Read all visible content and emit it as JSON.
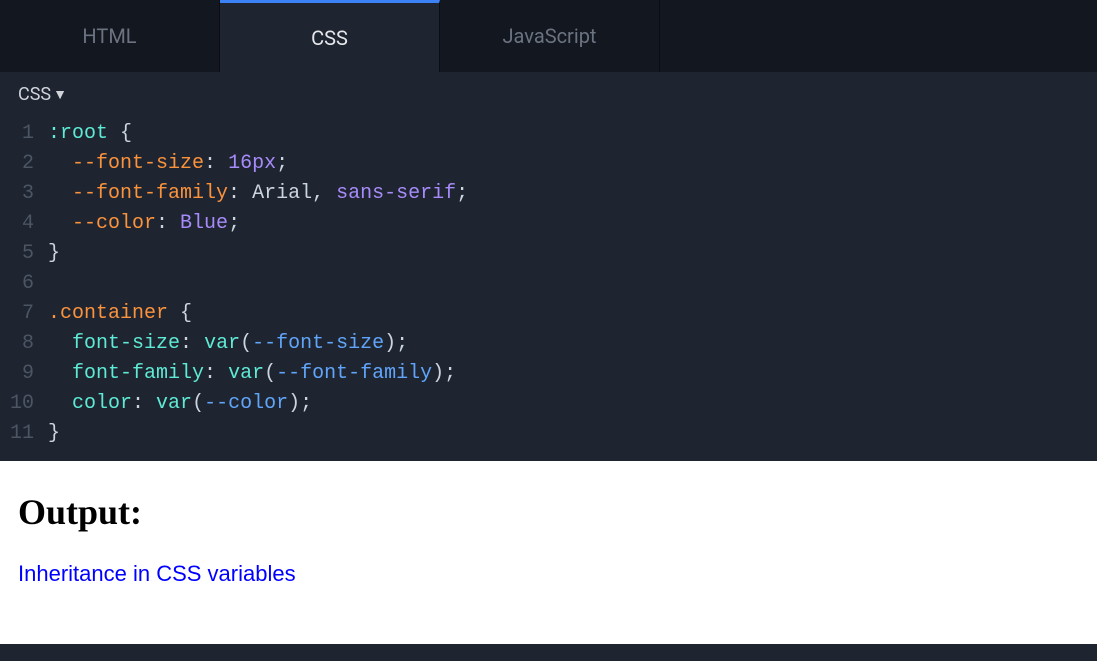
{
  "tabs": [
    {
      "label": "HTML",
      "active": false
    },
    {
      "label": "CSS",
      "active": true
    },
    {
      "label": "JavaScript",
      "active": false
    }
  ],
  "panel": {
    "language_label": "CSS",
    "dropdown_glyph": "▼"
  },
  "code_lines": [
    {
      "n": "1",
      "tokens": [
        [
          ":root",
          "tok-pseudo"
        ],
        [
          " {",
          "tok-punct"
        ]
      ]
    },
    {
      "n": "2",
      "tokens": [
        [
          "  ",
          ""
        ],
        [
          "--font-size",
          "tok-prop"
        ],
        [
          ": ",
          "tok-punct"
        ],
        [
          "16px",
          "tok-num"
        ],
        [
          ";",
          "tok-punct"
        ]
      ]
    },
    {
      "n": "3",
      "tokens": [
        [
          "  ",
          ""
        ],
        [
          "--font-family",
          "tok-prop"
        ],
        [
          ": ",
          "tok-punct"
        ],
        [
          "Arial",
          ""
        ],
        [
          ", ",
          "tok-punct"
        ],
        [
          "sans-serif",
          "tok-val2"
        ],
        [
          ";",
          "tok-punct"
        ]
      ]
    },
    {
      "n": "4",
      "tokens": [
        [
          "  ",
          ""
        ],
        [
          "--color",
          "tok-prop"
        ],
        [
          ": ",
          "tok-punct"
        ],
        [
          "Blue",
          "tok-val2"
        ],
        [
          ";",
          "tok-punct"
        ]
      ]
    },
    {
      "n": "5",
      "tokens": [
        [
          "}",
          "tok-punct"
        ]
      ]
    },
    {
      "n": "6",
      "tokens": [
        [
          "",
          ""
        ]
      ]
    },
    {
      "n": "7",
      "tokens": [
        [
          ".container",
          "tok-class"
        ],
        [
          " {",
          "tok-punct"
        ]
      ]
    },
    {
      "n": "8",
      "tokens": [
        [
          "  ",
          ""
        ],
        [
          "font-size",
          "tok-kw"
        ],
        [
          ": ",
          "tok-punct"
        ],
        [
          "var",
          "tok-kw"
        ],
        [
          "(",
          "tok-punct"
        ],
        [
          "--font-size",
          "tok-var"
        ],
        [
          ")",
          "tok-punct"
        ],
        [
          ";",
          "tok-punct"
        ]
      ]
    },
    {
      "n": "9",
      "tokens": [
        [
          "  ",
          ""
        ],
        [
          "font-family",
          "tok-kw"
        ],
        [
          ": ",
          "tok-punct"
        ],
        [
          "var",
          "tok-kw"
        ],
        [
          "(",
          "tok-punct"
        ],
        [
          "--font-family",
          "tok-var"
        ],
        [
          ")",
          "tok-punct"
        ],
        [
          ";",
          "tok-punct"
        ]
      ]
    },
    {
      "n": "10",
      "tokens": [
        [
          "  ",
          ""
        ],
        [
          "color",
          "tok-kw"
        ],
        [
          ": ",
          "tok-punct"
        ],
        [
          "var",
          "tok-kw"
        ],
        [
          "(",
          "tok-punct"
        ],
        [
          "--color",
          "tok-var"
        ],
        [
          ")",
          "tok-punct"
        ],
        [
          ";",
          "tok-punct"
        ]
      ]
    },
    {
      "n": "11",
      "tokens": [
        [
          "}",
          "tok-punct"
        ]
      ]
    }
  ],
  "output": {
    "heading": "Output:",
    "body_text": "Inheritance in CSS variables"
  }
}
